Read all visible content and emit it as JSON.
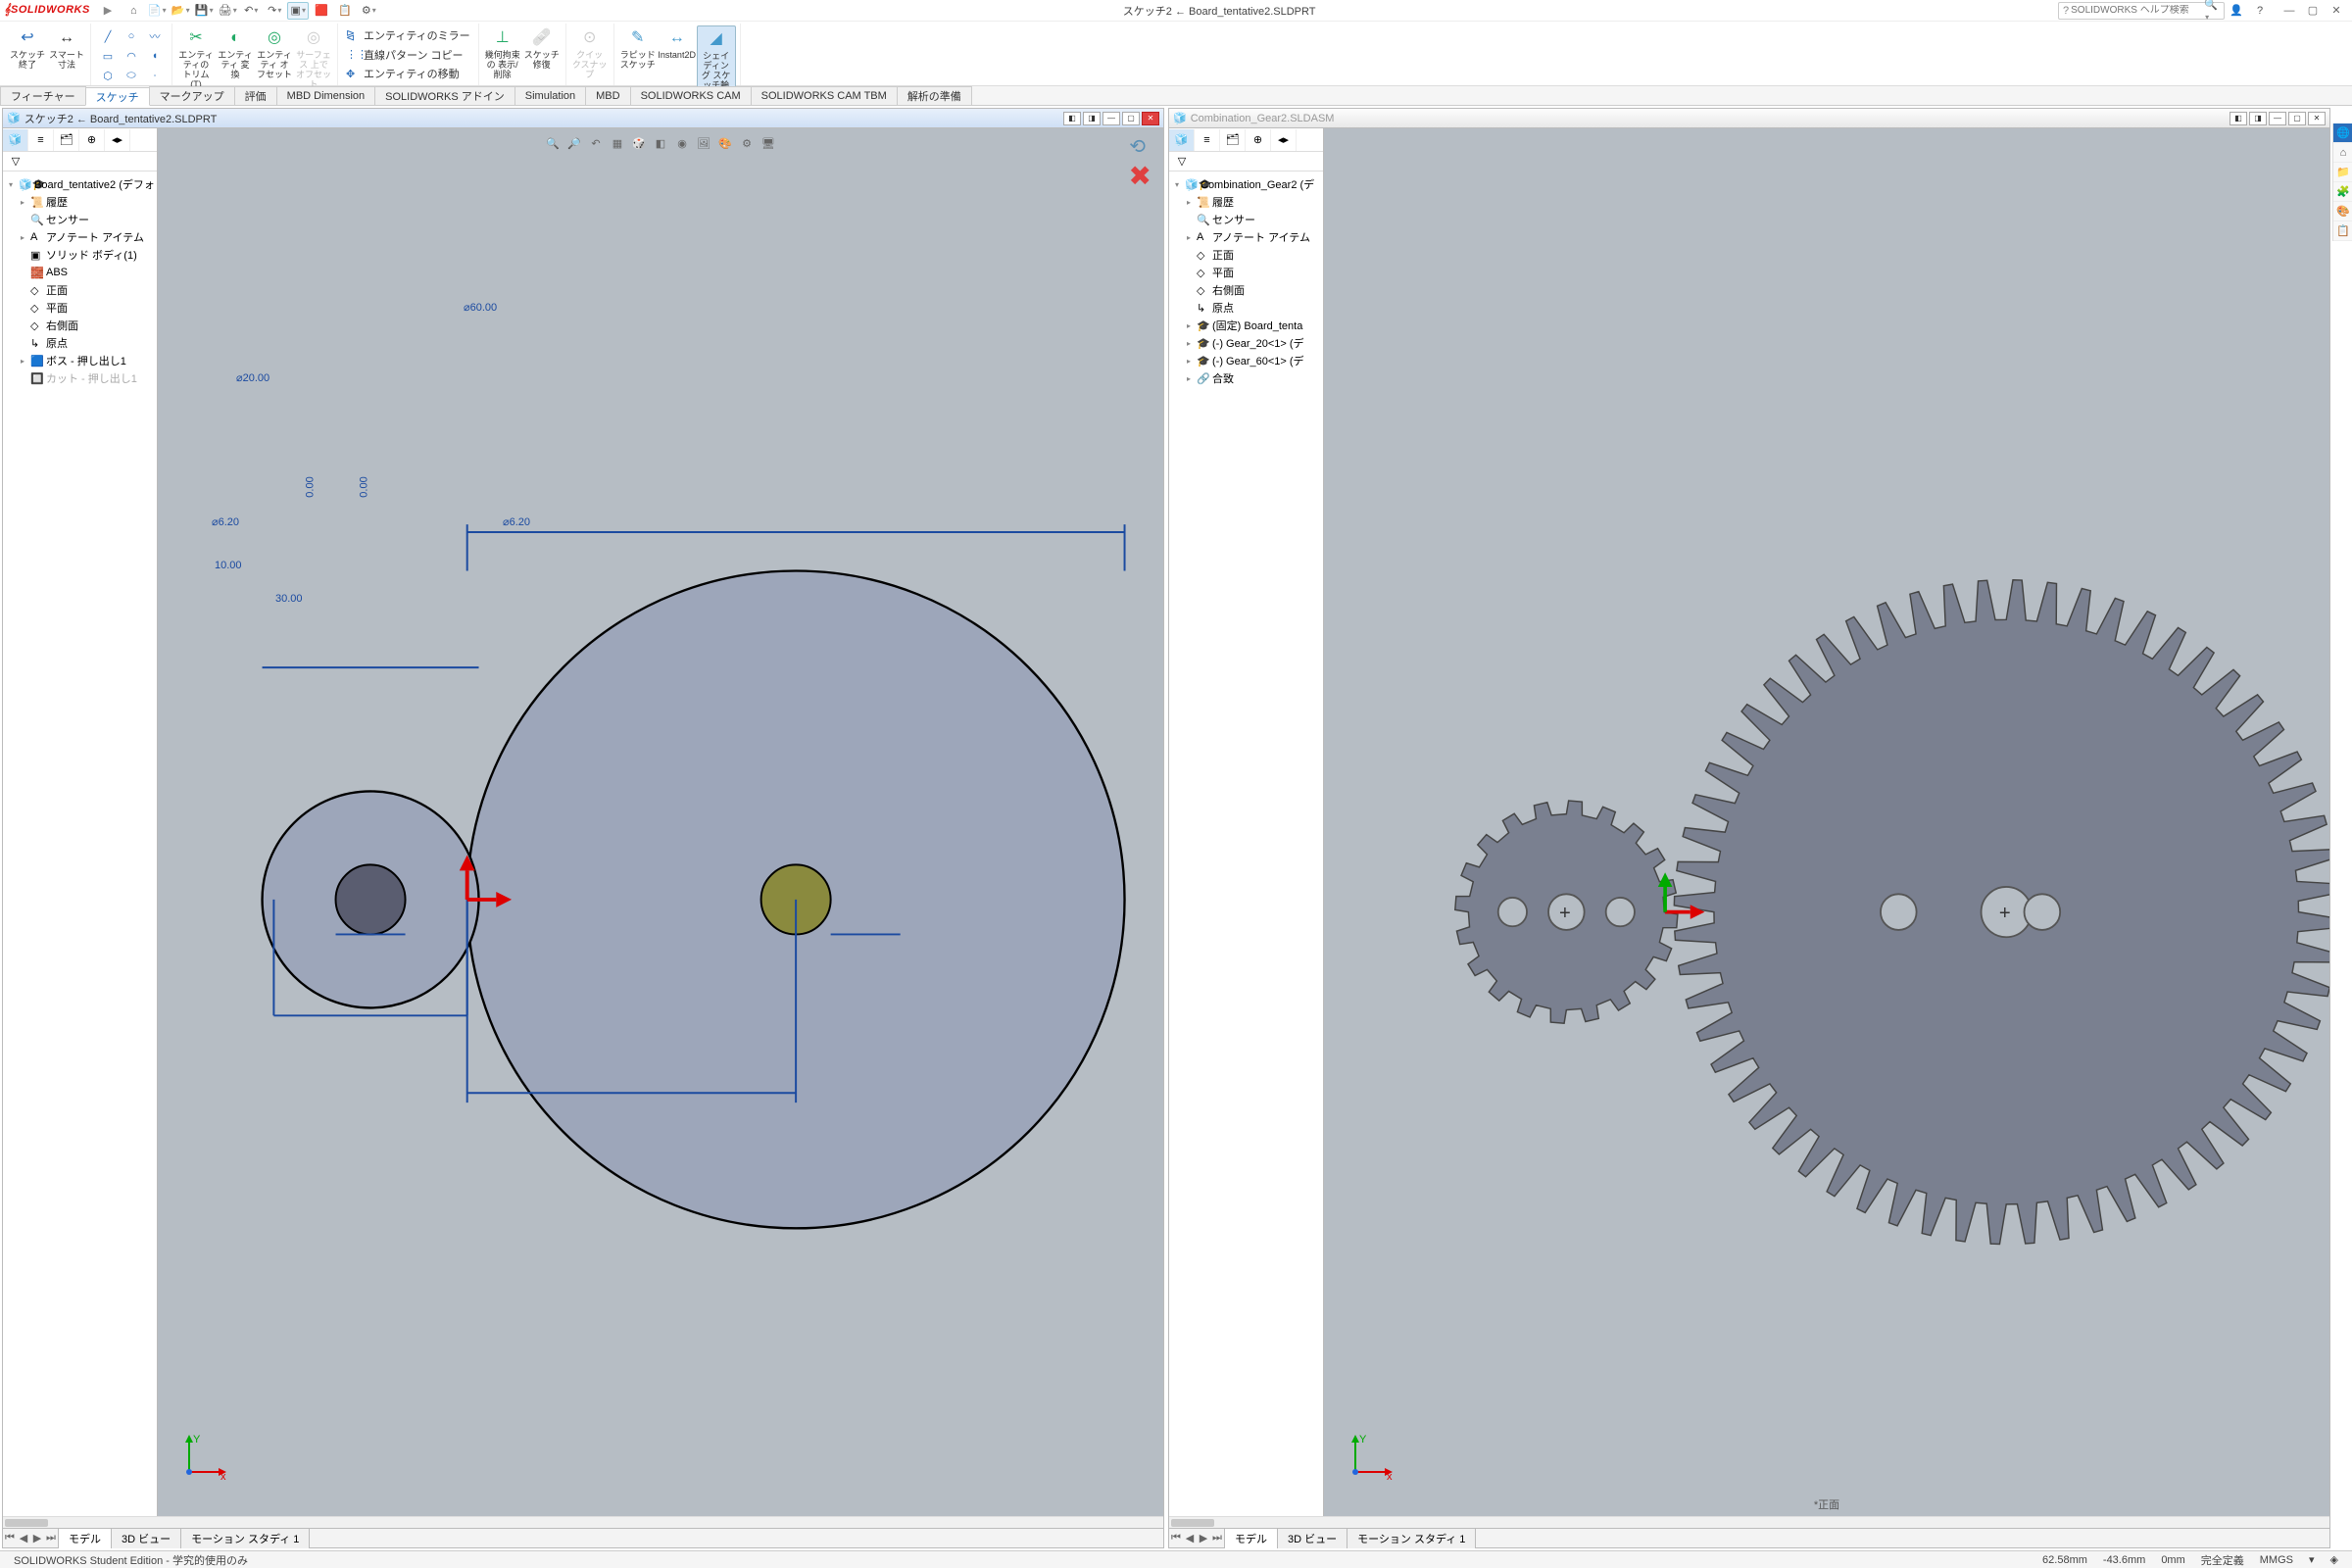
{
  "logo": "SOLIDWORKS",
  "play_arrow": "▶",
  "title": "スケッチ2 ← Board_tentative2.SLDPRT",
  "search_placeholder": "SOLIDWORKS ヘルプ検索",
  "toolbar_icons": [
    "⌂",
    "📄",
    "📂",
    "💾",
    "🖨",
    "↶",
    "↷",
    "▣",
    "⦿",
    "📋",
    "⚙"
  ],
  "ribbon": {
    "exit_sketch": "スケッチ\n終了",
    "smart_dim": "スマート\n寸法",
    "trim": "エンティティの\nトリム(T)",
    "convert": "エンティティ\n変換",
    "offset": "エンティティ\nオフセット",
    "surf_offset": "サーフェス\n上で\nオフセット",
    "mirror": "エンティティのミラー",
    "linear": "直線パターン コピー",
    "move": "エンティティの移動",
    "geom": "幾何拘束の\n表示/削除",
    "repair": "スケッチ\n修復",
    "quick": "クイックスナップ",
    "rapid": "ラピッドスケッチ",
    "instant": "Instant2D",
    "shaded": "シェイディング\nスケッチ輪郭"
  },
  "tabs": [
    "フィーチャー",
    "スケッチ",
    "マークアップ",
    "評価",
    "MBD Dimension",
    "SOLIDWORKS アドイン",
    "Simulation",
    "MBD",
    "SOLIDWORKS CAM",
    "SOLIDWORKS CAM TBM",
    "解析の準備"
  ],
  "active_tab": 1,
  "left_pane": {
    "title": "スケッチ2 ← Board_tentative2.SLDPRT",
    "root": "Board_tentative2 (デフォ",
    "items": [
      {
        "icon": "📜",
        "label": "履歴",
        "arrow": true
      },
      {
        "icon": "🔍",
        "label": "センサー"
      },
      {
        "icon": "A",
        "label": "アノテート アイテム",
        "arrow": true
      },
      {
        "icon": "▣",
        "label": "ソリッド ボディ(1)"
      },
      {
        "icon": "🧱",
        "label": "ABS"
      },
      {
        "icon": "◇",
        "label": "正面"
      },
      {
        "icon": "◇",
        "label": "平面"
      },
      {
        "icon": "◇",
        "label": "右側面"
      },
      {
        "icon": "↳",
        "label": "原点"
      },
      {
        "icon": "🟦",
        "label": "ボス - 押し出し1",
        "arrow": true
      },
      {
        "icon": "🔲",
        "label": "カット - 押し出し1",
        "dim": true
      }
    ],
    "bottom_tabs": [
      "モデル",
      "3D ビュー",
      "モーション スタディ 1"
    ],
    "dims": {
      "d60": "⌀60.00",
      "d20": "⌀20.00",
      "d62a": "⌀6.20",
      "d62b": "⌀6.20",
      "x10": "10.00",
      "x30": "30.00",
      "z0a": "0.00",
      "z0b": "0.00"
    }
  },
  "right_pane": {
    "title": "Combination_Gear2.SLDASM",
    "root": "Combination_Gear2 (デ",
    "items": [
      {
        "icon": "📜",
        "label": "履歴",
        "arrow": true
      },
      {
        "icon": "🔍",
        "label": "センサー"
      },
      {
        "icon": "A",
        "label": "アノテート アイテム",
        "arrow": true
      },
      {
        "icon": "◇",
        "label": "正面"
      },
      {
        "icon": "◇",
        "label": "平面"
      },
      {
        "icon": "◇",
        "label": "右側面"
      },
      {
        "icon": "↳",
        "label": "原点"
      },
      {
        "icon": "🎓",
        "label": "(固定) Board_tenta",
        "arrow": true
      },
      {
        "icon": "🎓",
        "label": "(-) Gear_20<1> (デ",
        "arrow": true
      },
      {
        "icon": "🎓",
        "label": "(-) Gear_60<1> (デ",
        "arrow": true
      },
      {
        "icon": "🔗",
        "label": "合致",
        "arrow": true
      }
    ],
    "bottom_tabs": [
      "モデル",
      "3D ビュー",
      "モーション スタディ 1"
    ],
    "view_name": "*正面"
  },
  "status": {
    "edition": "SOLIDWORKS Student Edition - 学究的使用のみ",
    "x": "62.58mm",
    "y": "-43.6mm",
    "z": "0mm",
    "state": "完全定義",
    "units": "MMGS"
  }
}
